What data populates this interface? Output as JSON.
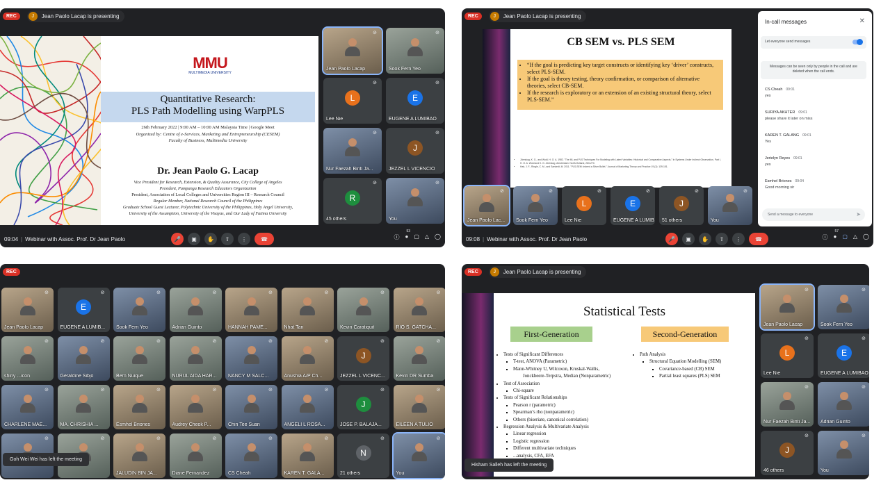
{
  "rec_label": "REC",
  "q1": {
    "presenting": "Jean Paolo Lacap is presenting",
    "slide": {
      "logo": "MMU",
      "logo_sub": "MULTIMEDIA UNIVERSITY",
      "title1": "Quantitative Research:",
      "title2": "PLS Path Modelling using WarpPLS",
      "date": "26th February 2022 | 9:00 AM – 10:00 AM Malaysia Time | Google Meet",
      "organized": "Organized by: Centre of e-Services, Marketing and Entrepreneurship (CESEM)",
      "faculty": "Faculty of Business, Multimedia University",
      "speaker": "Dr. Jean Paolo G. Lacap",
      "lines": [
        "Vice President for Research, Extension, & Quality Assurance, City College of Angeles",
        "President, Pampanga Research Educators Organization",
        "President, Association of Local Colleges and Universities Region III – Research Council",
        "Regular Member, National Research Council of the Philippines",
        "Graduate School Guest Lecturer, Polytechnic University of the Philippines, Holy Angel University,",
        "University of the Assumption, University of the Visayas, and Our Lady of Fatima University"
      ]
    },
    "tiles": [
      {
        "name": "Jean Paolo Lacap"
      },
      {
        "name": "Sook Fern Yeo"
      },
      {
        "name": "Lee Nie",
        "initial": "L"
      },
      {
        "name": "EUGENE A LUMIBAO",
        "initial": "E"
      },
      {
        "name": "Nur Faezah Binti Ja..."
      },
      {
        "name": "JEZZEL L VICENCIO",
        "initial": "J"
      },
      {
        "name": "45 others",
        "initial": "R"
      },
      {
        "name": "You"
      }
    ],
    "time": "09:04",
    "meeting": "Webinar with Assoc. Prof. Dr Jean Paolo",
    "people_count": "53"
  },
  "q2": {
    "presenting": "Jean Paolo Lacap is presenting",
    "slide": {
      "title": "CB SEM vs. PLS SEM",
      "bullets": [
        "“If the goal is predicting key target constructs or identifying key ‘driver’ constructs, select PLS-SEM.",
        "If the goal is theory testing, theory confirmation, or comparison of alternative theories, select CB-SEM.",
        "If the research is exploratory or an extension of an existing structural theory, select PLS-SEM.”"
      ],
      "refs": [
        "Jöreskog, K. G., and Wold, H. O. A. 1982. \"The ML and PLS Techniques For Modeling with Latent Variables: Historical and Comparative Aspects,\" In Systems Under Indirect Observation, Part I, H. O. A. Wold and K. G. Jöreskog. Amsterdam: North-Holland, 263-270.",
        "Hair, J. F., Ringle, C. M., and Sarstedt, M. 2011. \"PLS-SEM: Indeed a Silver Bullet,\" Journal of Marketing Theory and Practice 19 (2): 139-151."
      ]
    },
    "tiles": [
      {
        "name": "Jean Paolo Lac..."
      },
      {
        "name": "Sook Fern Yeo"
      },
      {
        "name": "Lee Nie",
        "initial": "L"
      },
      {
        "name": "EUGENE A LUMIBAO",
        "initial": "E"
      },
      {
        "name": "51 others",
        "initial": "J"
      },
      {
        "name": "You"
      }
    ],
    "chat": {
      "title": "In-call messages",
      "toggle_label": "Let everyone send messages",
      "notice": "Messages can be seen only by people in the call and are deleted when the call ends.",
      "messages": [
        {
          "sender": "CS Cheah",
          "time": "09:01",
          "text": "yes"
        },
        {
          "sender": "SURIYA AKHTER",
          "time": "09:01",
          "text": "please share it later on miss"
        },
        {
          "sender": "KAREN T. GALANG",
          "time": "09:01",
          "text": "Yes"
        },
        {
          "sender": "Jerielyn Reyes",
          "time": "09:01",
          "text": "yes"
        },
        {
          "sender": "Esmhel Briones",
          "time": "09:04",
          "text": "Good morning sir"
        }
      ],
      "input_placeholder": "Send a message to everyone"
    },
    "time": "09:08",
    "meeting": "Webinar with Assoc. Prof. Dr Jean Paolo",
    "people_count": "57"
  },
  "q3": {
    "tiles": [
      {
        "name": "Jean Paolo Lacap"
      },
      {
        "name": "EUGENE A LUMIB...",
        "initial": "E"
      },
      {
        "name": "Sook Fern Yeo"
      },
      {
        "name": "Adrian Guinto"
      },
      {
        "name": "HANNAH PAME..."
      },
      {
        "name": "Nhat Tan"
      },
      {
        "name": "Kevin Caratiquit"
      },
      {
        "name": "RIO S. GATCHA..."
      },
      {
        "name": "shiny ...icon"
      },
      {
        "name": "Geraldine Sibjo"
      },
      {
        "name": "Bern Nuique"
      },
      {
        "name": "NURUL AIDA HAR..."
      },
      {
        "name": "NANCY M SALC..."
      },
      {
        "name": "Anushia A/P Ch..."
      },
      {
        "name": "JEZZEL L VICENC...",
        "initial": "J"
      },
      {
        "name": "Kevin DR Sumba"
      },
      {
        "name": "CHARLENE MAE..."
      },
      {
        "name": "MA. CHRISHIA ..."
      },
      {
        "name": "Esmhel Briones"
      },
      {
        "name": "Audrey Cheok P..."
      },
      {
        "name": "Chin Tee Suan"
      },
      {
        "name": "ANGELI L ROSA..."
      },
      {
        "name": "JOSE P. BALAJA...",
        "initial": "J"
      },
      {
        "name": "EILEEN A TULIO"
      },
      {
        "name": ""
      },
      {
        "name": ""
      },
      {
        "name": "JALUDIN BIN JA..."
      },
      {
        "name": "Diane Fernandez"
      },
      {
        "name": "CS Cheah"
      },
      {
        "name": "KAREN T. GALA..."
      },
      {
        "name": "21 others",
        "initial": "N"
      },
      {
        "name": "You"
      }
    ],
    "toast": "Goh Wei Wei has left the meeting"
  },
  "q4": {
    "presenting": "Jean Paolo Lacap is presenting",
    "slide": {
      "title": "Statistical Tests",
      "first_gen": "First-Generation",
      "second_gen": "Second-Generation",
      "left_lines": [
        {
          "lvl": 1,
          "t": "Tests of Significant Differences"
        },
        {
          "lvl": 2,
          "t": "T-test, ANOVA (Parametric)"
        },
        {
          "lvl": 2,
          "t": "Mann-Whitney U, Wilcoxon, Kruskal-Wallis,"
        },
        {
          "lvl": 3,
          "t": "Jonckheere-Terpstra, Median (Nonparametric)"
        },
        {
          "lvl": 1,
          "t": "Test of Association"
        },
        {
          "lvl": 2,
          "t": "Chi-square"
        },
        {
          "lvl": 1,
          "t": "Tests of Significant Relationships"
        },
        {
          "lvl": 2,
          "t": "Pearson r (parametric)"
        },
        {
          "lvl": 2,
          "t": "Spearman’s rho (nonparametric)"
        },
        {
          "lvl": 2,
          "t": "Others (biseriate, canonical correlation)"
        },
        {
          "lvl": 1,
          "t": "Regression Analysis & Multivariate Analysis"
        },
        {
          "lvl": 2,
          "t": "Linear regression"
        },
        {
          "lvl": 2,
          "t": "Logistic regression"
        },
        {
          "lvl": 2,
          "t": "Different multivariate techniques"
        },
        {
          "lvl": 2,
          "t": "...analysis, CFA, EFA"
        }
      ],
      "right_lines": [
        {
          "lvl": 1,
          "t": "Path Analysis"
        },
        {
          "lvl": 2,
          "t": "Structural Equation Modelling (SEM)"
        },
        {
          "lvl": 3,
          "t": "Covariance-based (CB) SEM"
        },
        {
          "lvl": 3,
          "t": "Partial least squares (PLS) SEM"
        }
      ]
    },
    "tiles": [
      {
        "name": "Jean Paolo Lacap"
      },
      {
        "name": "Sook Fern Yeo"
      },
      {
        "name": "Lee Nie",
        "initial": "L"
      },
      {
        "name": "EUGENE A LUMIBAO",
        "initial": "E"
      },
      {
        "name": "Nur Faezah Binti Ja..."
      },
      {
        "name": "Adrian Guinto"
      },
      {
        "name": "46 others",
        "initial": "J"
      },
      {
        "name": "You"
      }
    ],
    "toast": "Hisham Salleh has left the meeting"
  },
  "colors": {
    "accent": "#8ab4f8",
    "red": "#ea4335",
    "bg": "#202124",
    "tile": "#3c4043"
  }
}
